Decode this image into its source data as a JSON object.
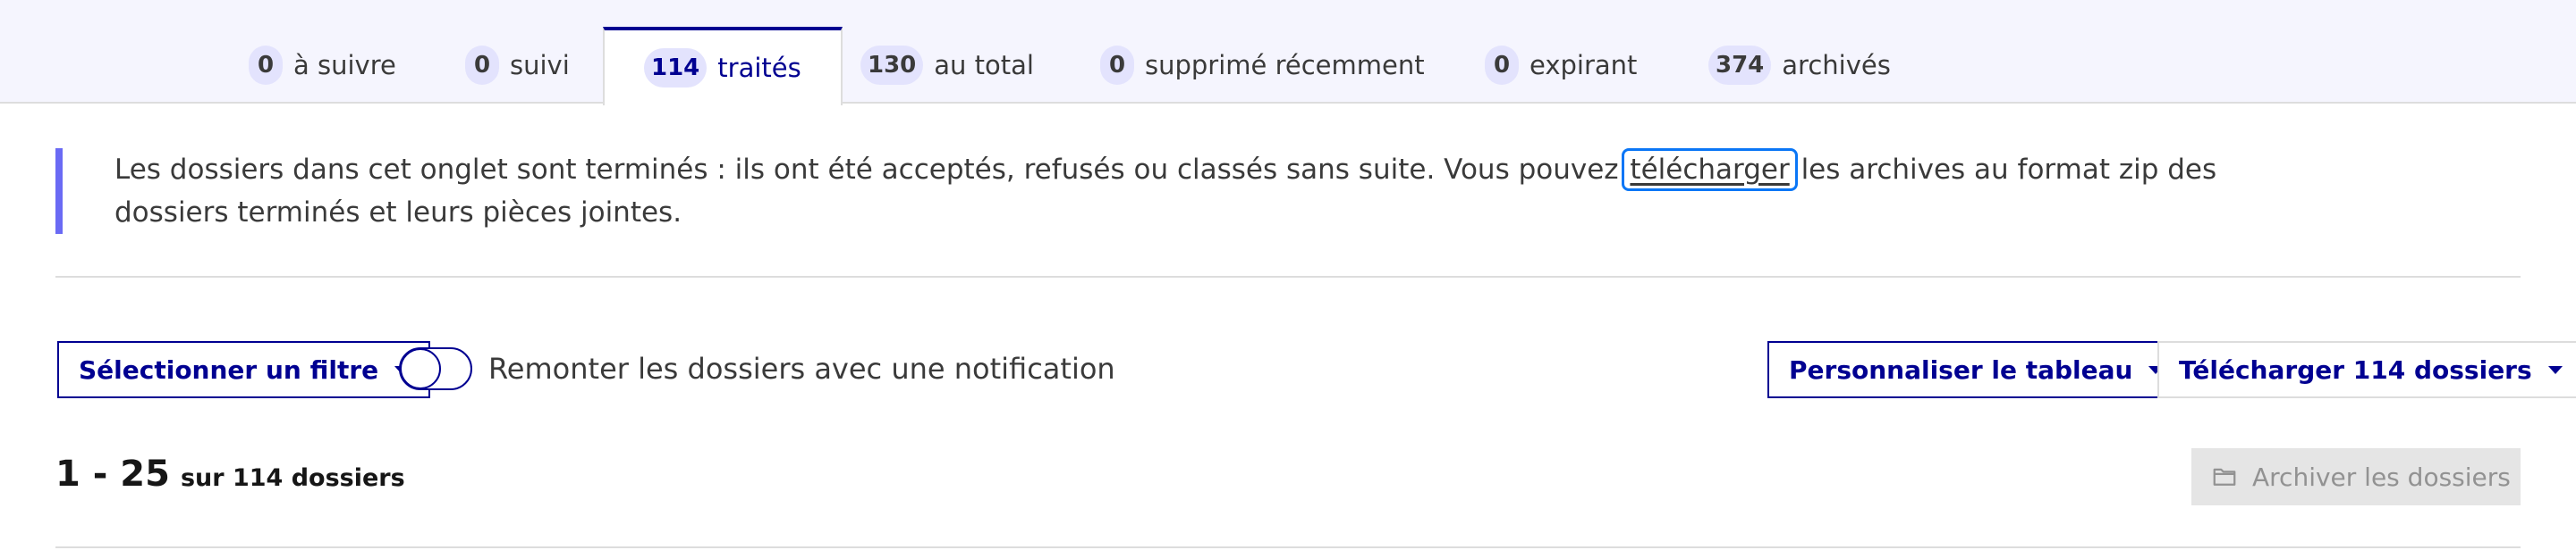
{
  "tabs": [
    {
      "count": "0",
      "label": "à suivre"
    },
    {
      "count": "0",
      "label": "suivi"
    },
    {
      "count": "114",
      "label": "traités"
    },
    {
      "count": "130",
      "label": "au total"
    },
    {
      "count": "0",
      "label": "supprimé récemment"
    },
    {
      "count": "0",
      "label": "expirant"
    },
    {
      "count": "374",
      "label": "archivés"
    }
  ],
  "active_tab": "traités",
  "notice": {
    "text_before": "Les dossiers dans cet onglet sont terminés : ils ont été acceptés, refusés ou classés sans suite. Vous pouvez ",
    "link_text": "télécharger",
    "text_after": " les archives au format zip des dossiers terminés et leurs pièces jointes."
  },
  "controls": {
    "filter_button": "Sélectionner un filtre",
    "toggle_label": "Remonter les dossiers avec une notification",
    "toggle_on": false,
    "customize_button": "Personnaliser le tableau",
    "download_button": "Télécharger 114 dossiers"
  },
  "summary": {
    "range": "1 - 25",
    "total": "sur 114 dossiers"
  },
  "archive_button": {
    "label": "Archiver les dossiers",
    "icon": "folder-icon",
    "disabled": true
  },
  "colors": {
    "primary": "#000091",
    "tab_bar_bg": "#f5f5fe",
    "badge_bg": "#e3e3fd",
    "notice_bar": "#6a6af4",
    "focus_ring": "#0a76f6"
  }
}
